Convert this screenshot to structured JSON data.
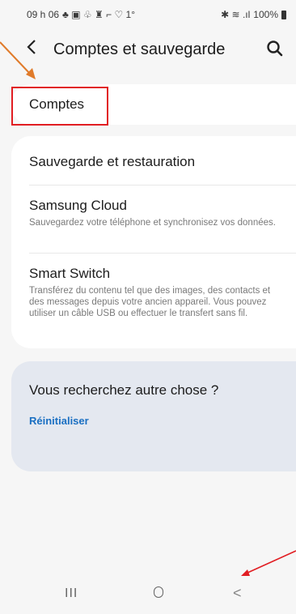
{
  "status": {
    "time": "09 h 06",
    "icons_left": "♣ ▣ ♧ ♜ ⌐ ♡ 1°",
    "icons_right": "✱ ≋ .ıl",
    "battery": "100%"
  },
  "header": {
    "title": "Comptes et sauvegarde",
    "back_icon": "chevron-left-icon",
    "search_icon": "search-icon"
  },
  "items": {
    "comptes": "Comptes",
    "backup": "Sauvegarde et restauration",
    "cloud_title": "Samsung Cloud",
    "cloud_sub": "Sauvegardez votre téléphone et synchronisez vos données.",
    "switch_title": "Smart Switch",
    "switch_sub": "Transférez du contenu tel que des images, des contacts et des messages depuis votre ancien appareil. Vous pouvez utiliser un câble USB ou effectuer le transfert sans fil."
  },
  "suggest": {
    "question": "Vous recherchez autre chose ?",
    "reset_label": "Réinitialiser"
  },
  "navbar": {
    "recents_glyph": "III",
    "back_glyph": "<"
  },
  "colors": {
    "accent_link": "#1a6fc2",
    "highlight_border": "#e11d22",
    "annotation_arrow": "#e07b2a"
  }
}
